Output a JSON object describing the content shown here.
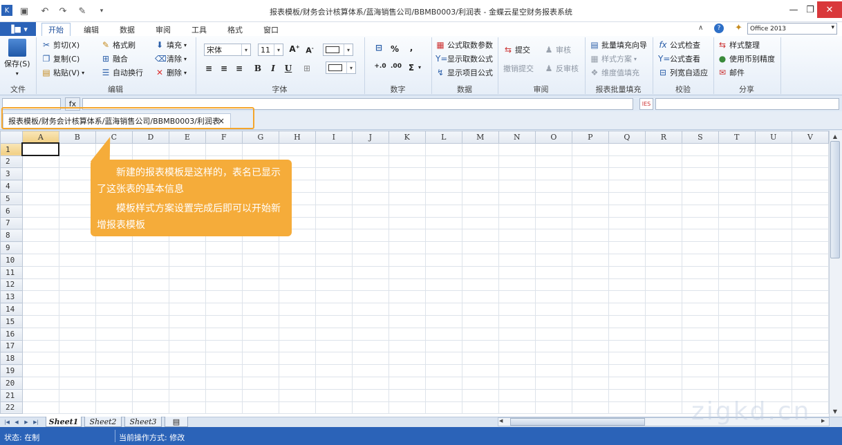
{
  "title_bar": {
    "title": "报表模板/财务会计核算体系/蓝海销售公司/BBMB0003/利润表 - 金蝶云星空财务报表系统",
    "min_icon": "minimize-icon",
    "restore_icon": "restore-icon",
    "close_icon": "close-icon"
  },
  "ribbon_tabs": {
    "file": "▐■ ▾",
    "tabs": [
      "开始",
      "编辑",
      "数据",
      "审阅",
      "工具",
      "格式",
      "窗口"
    ],
    "active": "开始",
    "office_theme": "Office 2013"
  },
  "ribbon": {
    "file_group": {
      "save": "保存(S)",
      "label": "文件"
    },
    "edit_group": {
      "cut": "剪切(X)",
      "copy": "复制(C)",
      "paste": "粘贴(V)",
      "format_painter": "格式刷",
      "merge": "融合",
      "wrap": "自动换行",
      "fill": "填充",
      "clear": "清除",
      "delete": "删除",
      "label": "编辑"
    },
    "font_group": {
      "font_name": "宋体",
      "font_size": "11",
      "label": "字体"
    },
    "number_group": {
      "label": "数字"
    },
    "data_group": {
      "formula_params": "公式取数参数",
      "show_formula": "显示取数公式",
      "show_project": "显示项目公式",
      "label": "数据"
    },
    "review_group": {
      "submit": "提交",
      "revoke": "撤销提交",
      "audit": "审核",
      "unaudit": "反审核",
      "label": "审阅"
    },
    "batch_group": {
      "batch_fill": "批量填充向导",
      "style_scheme": "样式方案",
      "dimension_fill": "维度值填充",
      "label": "报表批量填充"
    },
    "check_group": {
      "formula_check": "公式检查",
      "formula_view": "公式查看",
      "autofit": "列宽自适应",
      "label": "校验"
    },
    "share_group": {
      "style_tidy": "样式整理",
      "currency_precision": "使用币别精度",
      "mail": "邮件",
      "label": "分享"
    }
  },
  "formula_bar": {
    "fx": "fx",
    "calc": "IES"
  },
  "document_tab": {
    "label": "报表模板/财务会计核算体系/蓝海销售公司/BBMB0003/利润表",
    "close": "×"
  },
  "grid": {
    "columns": [
      "A",
      "B",
      "C",
      "D",
      "E",
      "F",
      "G",
      "H",
      "I",
      "J",
      "K",
      "L",
      "M",
      "N",
      "O",
      "P",
      "Q",
      "R",
      "S",
      "T",
      "U",
      "V"
    ],
    "rows": [
      "1",
      "2",
      "3",
      "4",
      "5",
      "6",
      "7",
      "8",
      "9",
      "10",
      "11",
      "12",
      "13",
      "14",
      "15",
      "16",
      "17",
      "18",
      "19",
      "20",
      "21",
      "22"
    ],
    "active_cell": "A1"
  },
  "sheets": {
    "tabs": [
      "Sheet1",
      "Sheet2",
      "Sheet3"
    ],
    "active": "Sheet1"
  },
  "status": {
    "state": "状态: 在制",
    "mode": "当前操作方式: 修改"
  },
  "callout": {
    "line1": "新建的报表模板是这样的，表名已显示了这张表的基本信息",
    "line2": "模板样式方案设置完成后即可以开始新增报表模板"
  },
  "watermark": "zigkd.cn",
  "colors": {
    "accent": "#2b63b8",
    "callout": "#f5ac3a",
    "highlight": "#f4a52b"
  }
}
